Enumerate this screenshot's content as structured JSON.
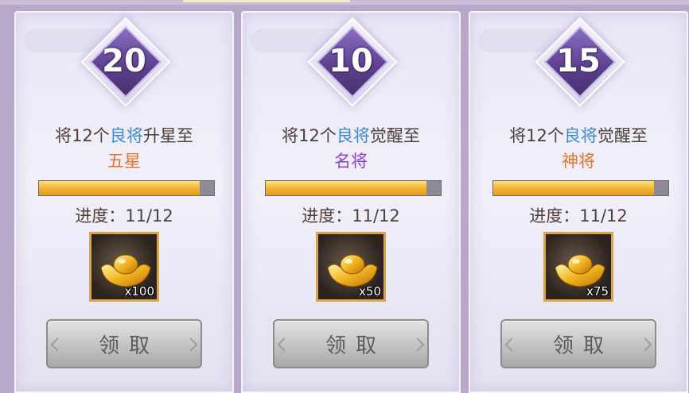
{
  "tasks": [
    {
      "level": "20",
      "desc_prefix": "将12个",
      "desc_highlight": "良将",
      "desc_suffix": "升星至",
      "grade": "五星",
      "grade_color": "#e8712a",
      "progress_label": "进度：11/12",
      "progress_fraction": 0.917,
      "reward_icon": "gold-ingot-icon",
      "reward_qty": "x100",
      "claim_label": "领取"
    },
    {
      "level": "10",
      "desc_prefix": "将12个",
      "desc_highlight": "良将",
      "desc_suffix": "觉醒至",
      "grade": "名将",
      "grade_color": "#8e3fd2",
      "progress_label": "进度：11/12",
      "progress_fraction": 0.917,
      "reward_icon": "gold-ingot-icon",
      "reward_qty": "x50",
      "claim_label": "领取"
    },
    {
      "level": "15",
      "desc_prefix": "将12个",
      "desc_highlight": "良将",
      "desc_suffix": "觉醒至",
      "grade": "神将",
      "grade_color": "#e8712a",
      "progress_label": "进度：11/12",
      "progress_fraction": 0.917,
      "reward_icon": "gold-ingot-icon",
      "reward_qty": "x75",
      "claim_label": "领取"
    }
  ]
}
